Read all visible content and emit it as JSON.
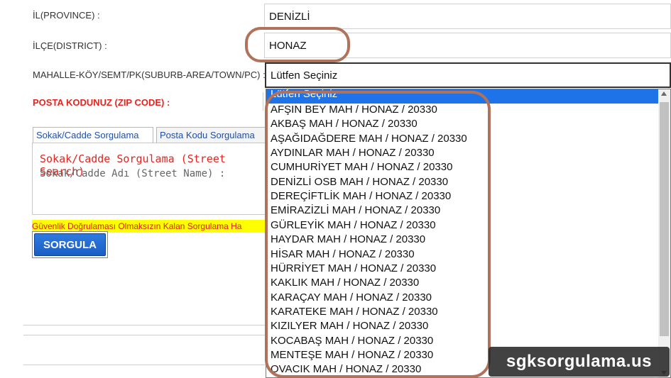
{
  "form": {
    "province_label": "İL(PROVINCE) :",
    "province_value": "DENİZLİ",
    "district_label": "İLÇE(DISTRICT) :",
    "district_value": "HONAZ",
    "suburb_label": "MAHALLE-KÖY/SEMT/PK(SUBURB-AREA/TOWN/PC) :",
    "suburb_value": "Lütfen Seçiniz",
    "zip_label": "POSTA KODUNUZ (ZIP CODE) :"
  },
  "tabs": [
    {
      "label": "Sokak/Cadde Sorgulama"
    },
    {
      "label": "Posta Kodu Sorgulama"
    }
  ],
  "panel": {
    "title": "Sokak/Cadde Sorgulama (Street Search)",
    "street_label": "Sokak/Cadde Adı (Street Name) :"
  },
  "warning": "Güvenlik Doğrulaması Olmaksızın Kalan Sorgulama Ha",
  "search_button": "SORGULA",
  "dropdown": {
    "items": [
      "Lütfen Seçiniz",
      "AFŞIN BEY MAH / HONAZ / 20330",
      "AKBAŞ MAH / HONAZ / 20330",
      "AŞAĞIDAĞDERE MAH / HONAZ / 20330",
      "AYDINLAR MAH / HONAZ / 20330",
      "CUMHURİYET MAH / HONAZ / 20330",
      "DENİZLİ OSB MAH / HONAZ / 20330",
      "DEREÇİFTLİK MAH / HONAZ / 20330",
      "EMİRAZİZLİ MAH / HONAZ / 20330",
      "GÜRLEYİK MAH / HONAZ / 20330",
      "HAYDAR MAH / HONAZ / 20330",
      "HİSAR MAH / HONAZ / 20330",
      "HÜRRİYET MAH / HONAZ / 20330",
      "KAKLIK MAH / HONAZ / 20330",
      "KARAÇAY MAH / HONAZ / 20330",
      "KARATEKE MAH / HONAZ / 20330",
      "KIZILYER MAH / HONAZ / 20330",
      "KOCABAŞ MAH / HONAZ / 20330",
      "MENTEŞE MAH / HONAZ / 20330",
      "OVACIK MAH / HONAZ / 20330"
    ],
    "selected_index": 0
  },
  "watermark": "sgksorgulama.us",
  "colors": {
    "highlight": "#1e73e8",
    "annotation_ring": "#b0725a",
    "warning_bg": "#ffff00",
    "zip_label": "#e8231d"
  },
  "icons": {
    "scroll_up": "triangle-up",
    "scroll_down": "triangle-down"
  }
}
